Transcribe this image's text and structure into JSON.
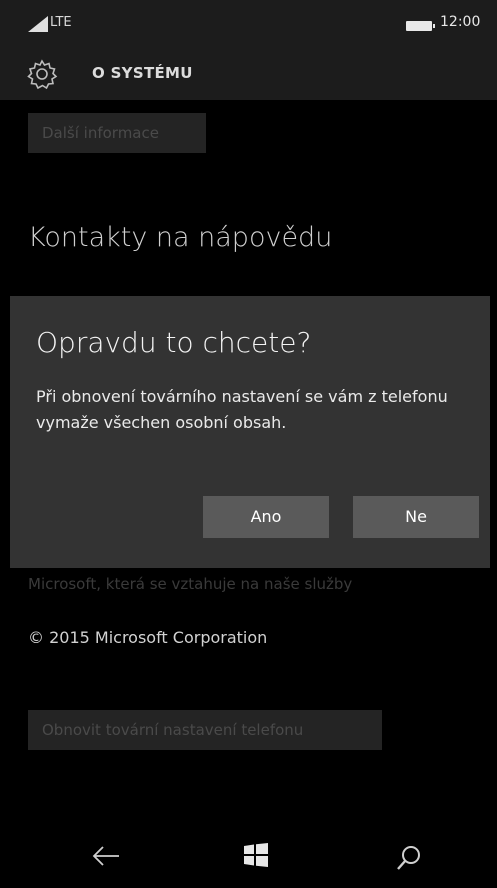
{
  "status": {
    "network": "LTE",
    "time": "12:00"
  },
  "header": {
    "title": "O SYSTÉMU"
  },
  "content": {
    "more_info_button": "Další informace",
    "help_contacts_heading": "Kontakty na nápovědu",
    "microsoft_text": "Microsoft, která se vztahuje na naše služby",
    "copyright": "© 2015 Microsoft Corporation",
    "reset_button": "Obnovit tovární nastavení telefonu"
  },
  "dialog": {
    "title": "Opravdu to chcete?",
    "message": "Při obnovení továrního nastavení se vám z telefonu vymaže všechen osobní obsah.",
    "yes_label": "Ano",
    "no_label": "Ne"
  },
  "icons": [
    "signal-icon",
    "battery-icon",
    "gear-icon",
    "back-icon",
    "windows-icon",
    "search-icon"
  ]
}
